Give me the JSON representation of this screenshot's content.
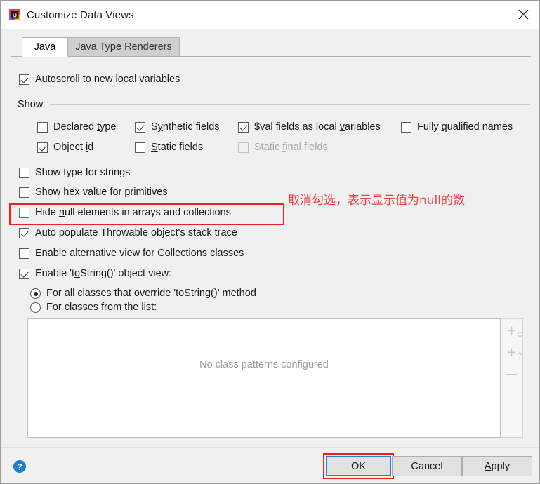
{
  "window": {
    "title": "Customize Data Views",
    "app_icon": "intellij-idea-icon",
    "close_label": "✕"
  },
  "tabs": [
    {
      "label": "Java",
      "active": true
    },
    {
      "label": "Java Type Renderers",
      "active": false
    }
  ],
  "options": {
    "autoscroll": {
      "label": "Autoscroll to new local variables",
      "checked": true
    },
    "show_group_label": "Show",
    "show_items": [
      {
        "label": "Declared type",
        "checked": false,
        "enabled": true
      },
      {
        "label": "Synthetic fields",
        "checked": true,
        "enabled": true
      },
      {
        "label": "$val fields as local variables",
        "checked": true,
        "enabled": true
      },
      {
        "label": "Fully qualified names",
        "checked": false,
        "enabled": true
      },
      {
        "label": "Object id",
        "checked": true,
        "enabled": true
      },
      {
        "label": "Static fields",
        "checked": false,
        "enabled": true
      },
      {
        "label": "Static final fields",
        "checked": false,
        "enabled": false
      }
    ],
    "main_items": [
      {
        "label": "Show type for strings",
        "checked": false,
        "focused": false
      },
      {
        "label": "Show hex value for primitives",
        "checked": false,
        "focused": false
      },
      {
        "label": "Hide null elements in arrays and collections",
        "checked": false,
        "focused": true
      },
      {
        "label": "Auto populate Throwable object's stack trace",
        "checked": true,
        "focused": false
      },
      {
        "label": "Enable alternative view for Collections classes",
        "checked": false,
        "focused": false
      },
      {
        "label": "Enable 'toString()' object view:",
        "checked": true,
        "focused": false
      }
    ],
    "tostring_radios": [
      {
        "label": "For all classes that override 'toString()' method",
        "selected": true
      },
      {
        "label": "For classes from the list:",
        "selected": false
      }
    ]
  },
  "class_list": {
    "empty_text": "No class patterns configured",
    "toolbar": [
      {
        "name": "add-class-pattern",
        "glyph": "+"
      },
      {
        "name": "add-class-pattern-help",
        "glyph": "+"
      },
      {
        "name": "remove-class-pattern",
        "glyph": "−"
      }
    ]
  },
  "annotations": {
    "note_text": "取消勾选，表示显示值为null的数",
    "note_color": "#f04040",
    "highlight_color": "#ef2020"
  },
  "footer": {
    "help": "?",
    "ok": "OK",
    "cancel": "Cancel",
    "apply_pre": "A",
    "apply_post": "pply"
  }
}
